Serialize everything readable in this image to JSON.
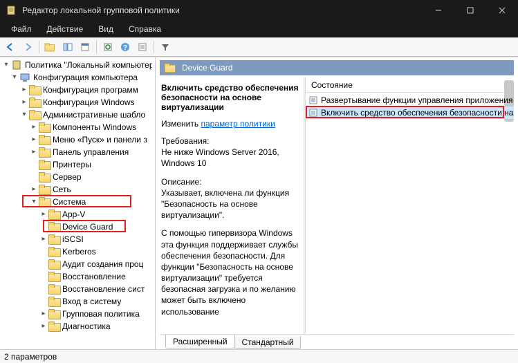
{
  "titlebar": {
    "title": "Редактор локальной групповой политики"
  },
  "menu": {
    "file": "Файл",
    "action": "Действие",
    "view": "Вид",
    "help": "Справка"
  },
  "tree": {
    "root": "Политика \"Локальный компьютер\"",
    "comp_config": "Конфигурация компьютера",
    "soft_config": "Конфигурация программ",
    "win_config": "Конфигурация Windows",
    "admin_templates": "Административные шабло",
    "win_components": "Компоненты Windows",
    "start_menu": "Меню «Пуск» и панели з",
    "control_panel": "Панель управления",
    "printers": "Принтеры",
    "server": "Сервер",
    "network": "Сеть",
    "system": "Система",
    "appv": "App-V",
    "device_guard": "Device Guard",
    "iscsi": "iSCSI",
    "kerberos": "Kerberos",
    "audit": "Аудит создания проц",
    "recovery": "Восстановление",
    "recovery2": "Восстановление сист",
    "logon": "Вход в систему",
    "group_policy": "Групповая политика",
    "diagnostics": "Диагностика"
  },
  "right": {
    "header": "Device Guard",
    "setting_title": "Включить средство обеспечения безопасности на основе виртуализации",
    "edit_prefix": "Изменить ",
    "edit_link": "параметр политики",
    "req_label": "Требования:",
    "req_text": "Не ниже Windows Server 2016, Windows 10",
    "desc_label": "Описание:",
    "desc_text": "Указывает, включена ли функция \"Безопасность на основе виртуализации\".",
    "desc_text2": "С помощью гипервизора Windows эта функция поддерживает службы обеспечения безопасности. Для функции \"Безопасность на основе виртуализации\" требуется безопасная загрузка и по желанию может быть включено использование",
    "col_state": "Состояние",
    "row1": "Развертывание функции управления приложения",
    "row2": "Включить средство обеспечения безопасности на"
  },
  "tabs": {
    "extended": "Расширенный",
    "standard": "Стандартный"
  },
  "status": {
    "text": "2 параметров"
  }
}
